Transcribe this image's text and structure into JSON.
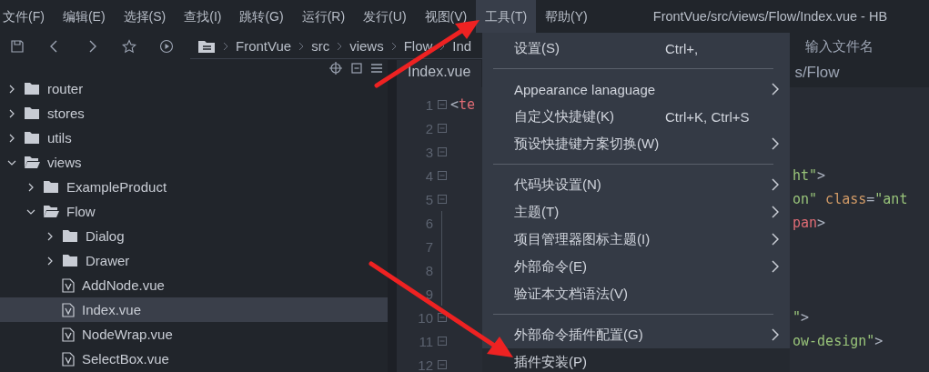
{
  "menubar": {
    "items": [
      {
        "label": "文件(F)",
        "selected": false
      },
      {
        "label": "编辑(E)",
        "selected": false
      },
      {
        "label": "选择(S)",
        "selected": false
      },
      {
        "label": "查找(I)",
        "selected": false
      },
      {
        "label": "跳转(G)",
        "selected": false
      },
      {
        "label": "运行(R)",
        "selected": false
      },
      {
        "label": "发行(U)",
        "selected": false
      },
      {
        "label": "视图(V)",
        "selected": false
      },
      {
        "label": "工具(T)",
        "selected": true
      },
      {
        "label": "帮助(Y)",
        "selected": false
      }
    ],
    "title": "FrontVue/src/views/Flow/Index.vue - HB"
  },
  "toolbar": {
    "breadcrumb": [
      "FrontVue",
      "src",
      "views",
      "Flow",
      "Ind"
    ],
    "search": {
      "placeholder": "输入文件名"
    }
  },
  "sidebar": {
    "tree": [
      {
        "name": "router",
        "kind": "folder",
        "expanded": false,
        "selected": false
      },
      {
        "name": "stores",
        "kind": "folder",
        "expanded": false,
        "selected": false
      },
      {
        "name": "utils",
        "kind": "folder",
        "expanded": false,
        "selected": false
      },
      {
        "name": "views",
        "kind": "folder",
        "expanded": true,
        "selected": false,
        "children": [
          {
            "name": "ExampleProduct",
            "kind": "folder",
            "expanded": false,
            "selected": false
          },
          {
            "name": "Flow",
            "kind": "folder",
            "expanded": true,
            "selected": false,
            "children": [
              {
                "name": "Dialog",
                "kind": "folder",
                "expanded": false,
                "selected": false
              },
              {
                "name": "Drawer",
                "kind": "folder",
                "expanded": false,
                "selected": false
              },
              {
                "name": "AddNode.vue",
                "kind": "file",
                "selected": false
              },
              {
                "name": "Index.vue",
                "kind": "file",
                "selected": true
              },
              {
                "name": "NodeWrap.vue",
                "kind": "file",
                "selected": false
              },
              {
                "name": "SelectBox.vue",
                "kind": "file",
                "selected": false
              }
            ]
          }
        ]
      }
    ]
  },
  "editor": {
    "tabs": [
      {
        "label": "Index.vue",
        "selected": true
      },
      {
        "label": "s/Flow",
        "selected": false
      }
    ],
    "lines": [
      {
        "number": "1",
        "foldable": true,
        "cut_by_menu": false,
        "tokens": [
          {
            "text": "<",
            "kind": "punct"
          },
          {
            "text": "te",
            "kind": "tag"
          }
        ]
      },
      {
        "number": "2",
        "foldable": true
      },
      {
        "number": "3",
        "foldable": true
      },
      {
        "number": "4",
        "foldable": true,
        "cut_by_menu": true,
        "tokens": [
          {
            "text": "ht\"",
            "kind": "string"
          },
          {
            "text": ">",
            "kind": "punct"
          }
        ]
      },
      {
        "number": "5",
        "foldable": true,
        "cut_by_menu": true,
        "tokens": [
          {
            "text": "on\"",
            "kind": "string"
          },
          {
            "text": " class",
            "kind": "attr"
          },
          {
            "text": "=",
            "kind": "punct"
          },
          {
            "text": "\"ant",
            "kind": "string"
          }
        ]
      },
      {
        "number": "6",
        "foldable": false,
        "cut_by_menu": true,
        "tokens": [
          {
            "text": "pan",
            "kind": "tag"
          },
          {
            "text": ">",
            "kind": "punct"
          }
        ]
      },
      {
        "number": "7",
        "foldable": false
      },
      {
        "number": "8",
        "foldable": false
      },
      {
        "number": "9",
        "foldable": false
      },
      {
        "number": "10",
        "foldable": true,
        "cut_by_menu": true,
        "tokens": [
          {
            "text": "\"",
            "kind": "string"
          },
          {
            "text": ">",
            "kind": "punct"
          }
        ]
      },
      {
        "number": "11",
        "foldable": true,
        "cut_by_menu": true,
        "tokens": [
          {
            "text": "ow-design\"",
            "kind": "string"
          },
          {
            "text": ">",
            "kind": "punct"
          }
        ]
      },
      {
        "number": "12",
        "foldable": true
      }
    ]
  },
  "tools_menu": {
    "items": [
      {
        "kind": "item",
        "label": "设置(S)",
        "shortcut": "Ctrl+,",
        "submenu": false,
        "selected": false
      },
      {
        "kind": "separator"
      },
      {
        "kind": "item",
        "label": "Appearance lanaguage",
        "submenu": true,
        "selected": false
      },
      {
        "kind": "item",
        "label": "自定义快捷键(K)",
        "shortcut": "Ctrl+K, Ctrl+S",
        "submenu": false,
        "selected": false
      },
      {
        "kind": "item",
        "label": "预设快捷键方案切换(W)",
        "submenu": true,
        "selected": false
      },
      {
        "kind": "separator"
      },
      {
        "kind": "item",
        "label": "代码块设置(N)",
        "submenu": true,
        "selected": false
      },
      {
        "kind": "item",
        "label": "主题(T)",
        "submenu": true,
        "selected": false
      },
      {
        "kind": "item",
        "label": "项目管理器图标主题(I)",
        "submenu": true,
        "selected": false
      },
      {
        "kind": "item",
        "label": "外部命令(E)",
        "submenu": true,
        "selected": false
      },
      {
        "kind": "item",
        "label": "验证本文档语法(V)",
        "submenu": false,
        "selected": false
      },
      {
        "kind": "separator"
      },
      {
        "kind": "item",
        "label": "外部命令插件配置(G)",
        "submenu": true,
        "selected": false
      },
      {
        "kind": "item",
        "label": "插件安装(P)",
        "submenu": false,
        "selected": true
      }
    ]
  }
}
